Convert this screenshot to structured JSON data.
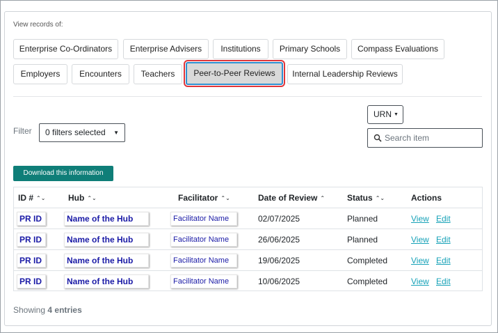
{
  "view_records_label": "View records of:",
  "tabs_row1": [
    "Enterprise Co-Ordinators",
    "Enterprise Advisers",
    "Institutions",
    "Primary Schools",
    "Compass Evaluations"
  ],
  "tabs_row2": [
    "Employers",
    "Encounters",
    "Teachers",
    "Peer-to-Peer Reviews",
    "Internal Leadership Reviews"
  ],
  "active_tab": "Peer-to-Peer Reviews",
  "filter": {
    "label": "Filter",
    "selected": "0 filters selected"
  },
  "urn_button": "URN",
  "search": {
    "placeholder": "Search item"
  },
  "download_button": "Download this information",
  "table": {
    "headers": {
      "id": "ID #",
      "hub": "Hub",
      "facilitator": "Facilitator",
      "date": "Date of Review",
      "status": "Status",
      "actions": "Actions"
    },
    "rows": [
      {
        "id": "PR ID",
        "hub": "Name of the Hub",
        "facilitator": "Facilitator Name",
        "date": "02/07/2025",
        "status": "Planned",
        "view": "View",
        "edit": "Edit"
      },
      {
        "id": "PR ID",
        "hub": "Name of the Hub",
        "facilitator": "Facilitator Name",
        "date": "26/06/2025",
        "status": "Planned",
        "view": "View",
        "edit": "Edit"
      },
      {
        "id": "PR ID",
        "hub": "Name of the Hub",
        "facilitator": "Facilitator Name",
        "date": "19/06/2025",
        "status": "Completed",
        "view": "View",
        "edit": "Edit"
      },
      {
        "id": "PR ID",
        "hub": "Name of the Hub",
        "facilitator": "Facilitator Name",
        "date": "10/06/2025",
        "status": "Completed",
        "view": "View",
        "edit": "Edit"
      }
    ]
  },
  "footer": {
    "prefix": "Showing",
    "count": "4",
    "suffix": "entries"
  },
  "colors": {
    "accent": "#0f7e78",
    "link": "#17a2b8",
    "highlight_outline": "#e0353a",
    "pill_text": "#1a1aa6"
  }
}
